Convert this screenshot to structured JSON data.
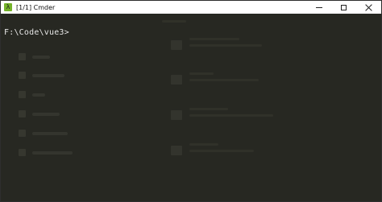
{
  "window": {
    "title": "[1/1] Cmder",
    "app_icon_glyph": "λ",
    "accent_color": "#74b32a",
    "terminal_bg": "#272822",
    "text_color": "#e6e6e6"
  },
  "terminal": {
    "prompt": "F:\\Code\\vue3>"
  }
}
